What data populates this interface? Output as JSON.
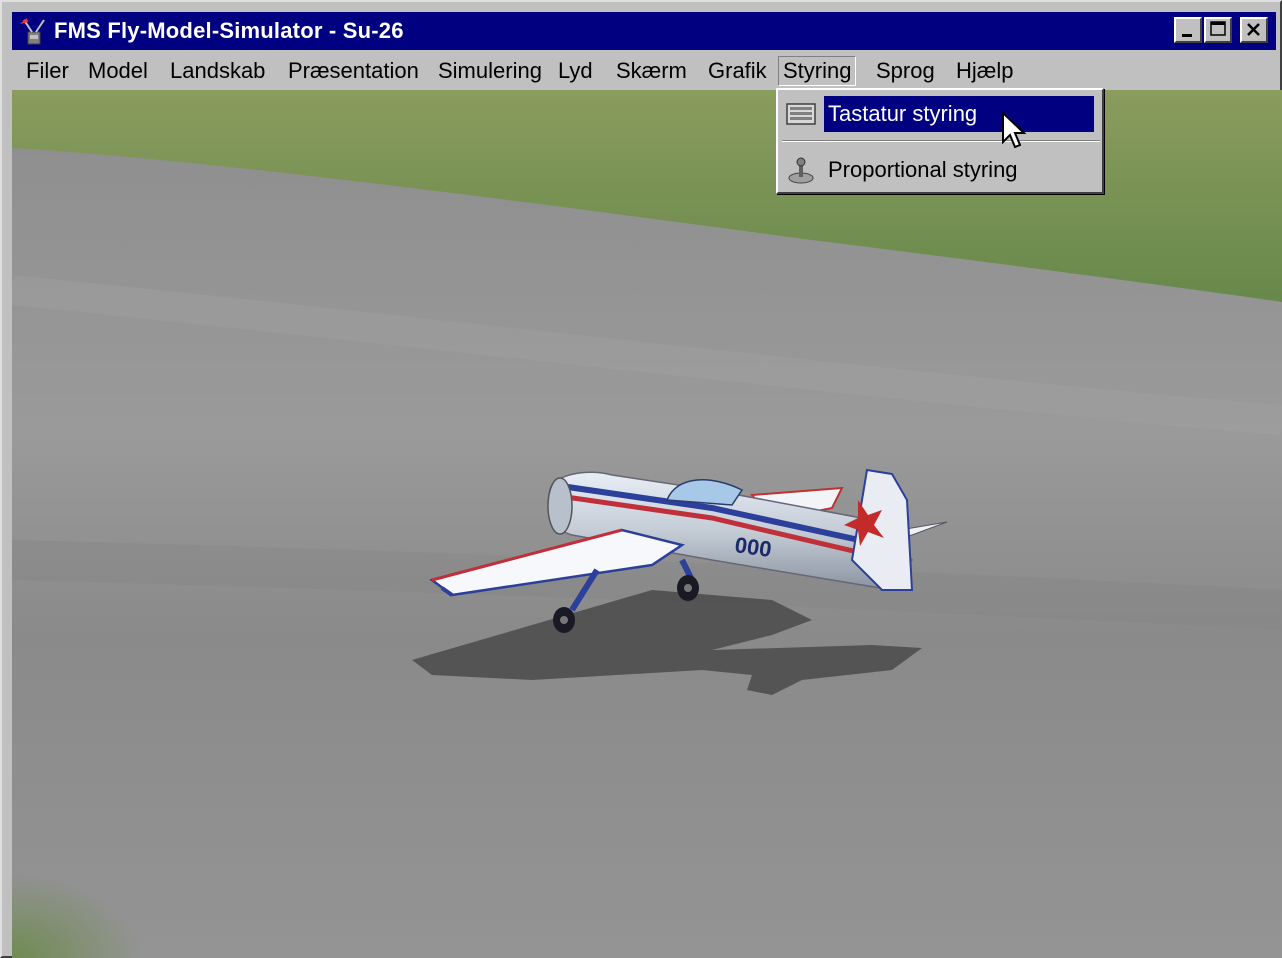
{
  "window": {
    "title": "FMS Fly-Model-Simulator - Su-26",
    "titlebar_color": "#000080",
    "controls": [
      "minimize-icon",
      "maximize-icon",
      "close-icon"
    ]
  },
  "menubar": {
    "items": [
      {
        "label": "Filer",
        "accel": "F"
      },
      {
        "label": "Model",
        "accel": "M"
      },
      {
        "label": "Landskab",
        "accel": "L"
      },
      {
        "label": "Præsentation",
        "accel": "r"
      },
      {
        "label": "Simulering",
        "accel": "S"
      },
      {
        "label": "Lyd",
        "accel": "y"
      },
      {
        "label": "Skærm",
        "accel": "k"
      },
      {
        "label": "Grafik",
        "accel": "G"
      },
      {
        "label": "Styring",
        "accel": "y",
        "open": true
      },
      {
        "label": "Sprog",
        "accel": "r"
      },
      {
        "label": "Hjælp",
        "accel": "H"
      }
    ]
  },
  "dropdown": {
    "items": [
      {
        "label": "Tastatur styring",
        "accel": "T",
        "icon": "keyboard-icon",
        "selected": true
      },
      {
        "label": "Proportional styring",
        "accel": "P",
        "icon": "joystick-icon",
        "selected": false
      }
    ]
  },
  "scene": {
    "description_icon": "airplane-3d-view",
    "aircraft_marking": "000",
    "colors": {
      "grass": "#6e8f4c",
      "tarmac": "#8c8c8c"
    }
  }
}
